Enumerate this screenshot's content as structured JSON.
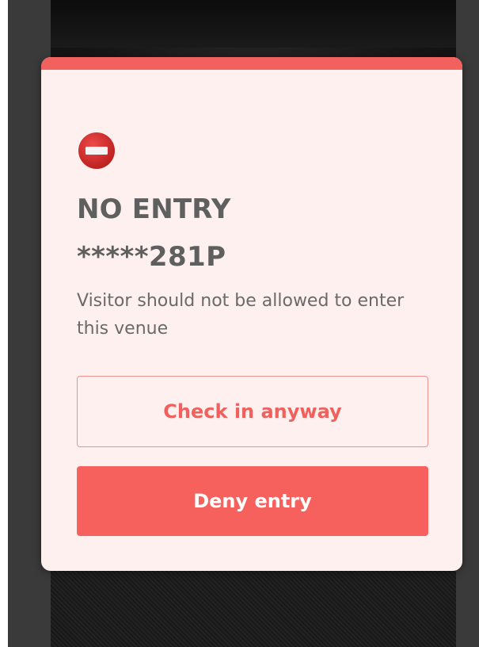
{
  "modal": {
    "icon": "no-entry-icon",
    "title": "NO ENTRY",
    "visitor_id": "*****281P",
    "message": "Visitor should not be allowed to enter this venue",
    "check_in_label": "Check in anyway",
    "deny_label": "Deny entry"
  },
  "colors": {
    "accent": "#f2615e",
    "modal_background": "#fdf0ef",
    "text_dark": "#5f5f5f",
    "icon_red": "#d42b2b"
  }
}
